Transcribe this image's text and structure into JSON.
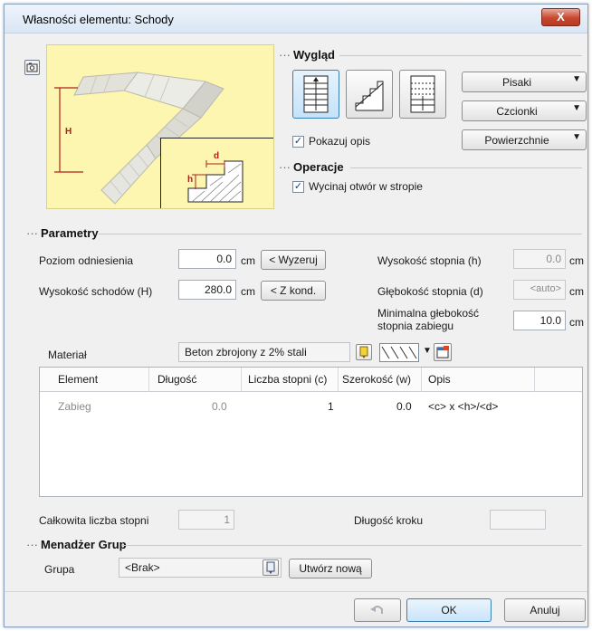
{
  "window": {
    "title": "Własności elementu: Schody",
    "close_label": "X"
  },
  "preview": {
    "label_H": "H",
    "label_h": "h",
    "label_d": "d"
  },
  "wyglad": {
    "header": "Wygląd",
    "dropdowns": [
      {
        "label": "Pisaki",
        "arrow": "▼"
      },
      {
        "label": "Czcionki",
        "arrow": "▼"
      },
      {
        "label": "Powierzchnie",
        "arrow": "▼"
      }
    ],
    "show_description": {
      "label": "Pokazuj opis",
      "checked": true
    }
  },
  "operacje": {
    "header": "Operacje",
    "cut_opening": {
      "label": "Wycinaj otwór w stropie",
      "checked": true
    }
  },
  "parametry": {
    "header": "Parametry",
    "poziom": {
      "label": "Poziom odniesienia",
      "value": "0.0",
      "unit": "cm",
      "button": "< Wyzeruj"
    },
    "wysokosc_schodow": {
      "label": "Wysokość schodów (H)",
      "value": "280.0",
      "unit": "cm",
      "button": "< Z kond."
    },
    "wysokosc_stopnia": {
      "label": "Wysokość stopnia (h)",
      "value": "0.0",
      "unit": "cm"
    },
    "glebokosc_stopnia": {
      "label": "Głębokość stopnia (d)",
      "value": "<auto>",
      "unit": "cm"
    },
    "min_glebokosc": {
      "label_line1": "Minimalna głebokość",
      "label_line2": "stopnia zabiegu",
      "value": "10.0",
      "unit": "cm"
    },
    "material": {
      "label": "Materiał",
      "value": "Beton zbrojony z 2% stali"
    }
  },
  "table": {
    "columns": [
      "Element",
      "Długość",
      "Liczba stopni (c)",
      "Szerokość (w)",
      "Opis"
    ],
    "rows": [
      {
        "element": "Zabieg",
        "dlugosc": "0.0",
        "liczba": "1",
        "szerokosc": "0.0",
        "opis": "<c> x <h>/<d>"
      }
    ]
  },
  "totals": {
    "liczba_stopni_label": "Całkowita liczba stopni",
    "liczba_stopni_value": "1",
    "dlugosc_kroku_label": "Długość kroku",
    "dlugosc_kroku_value": ""
  },
  "menadzer": {
    "header": "Menadżer Grup",
    "grupa_label": "Grupa",
    "grupa_value": "<Brak>",
    "create_button": "Utwórz nową"
  },
  "footer": {
    "ok": "OK",
    "cancel": "Anuluj"
  },
  "colors": {
    "preview_bg": "#fdf6b0",
    "dimension_red": "#b0201a",
    "active_blue": "#3c7fb1"
  }
}
